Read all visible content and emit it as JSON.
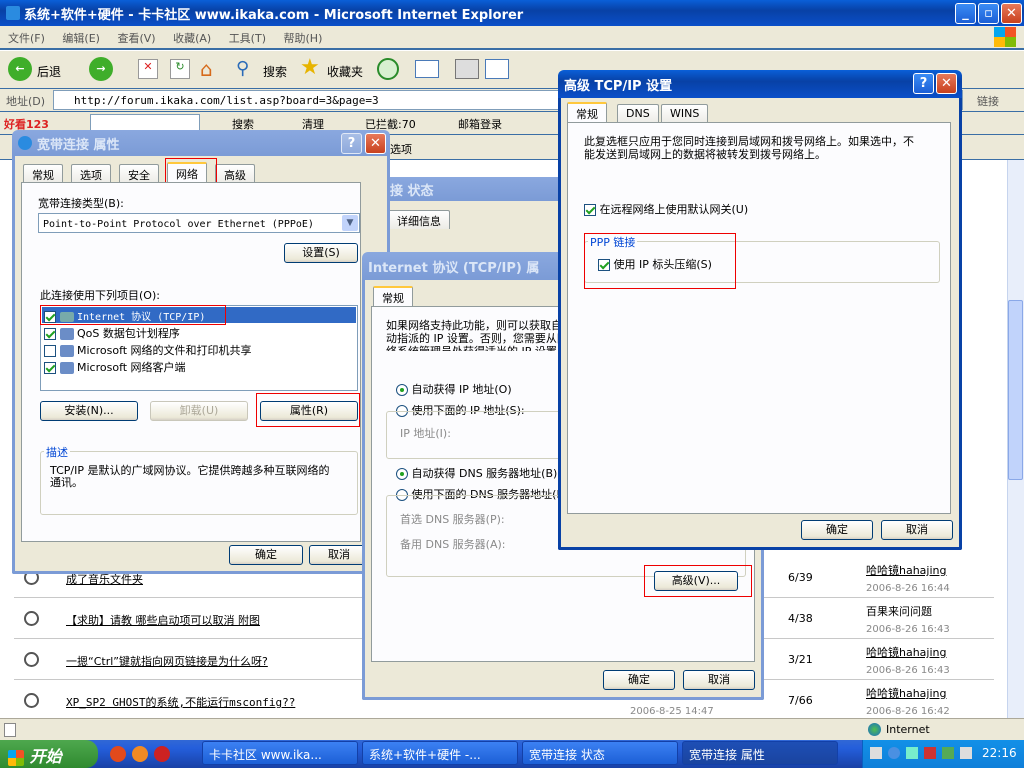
{
  "ie": {
    "title": "系统+软件+硬件 - 卡卡社区 www.ikaka.com - Microsoft Internet Explorer",
    "menu": [
      "文件(F)",
      "编辑(E)",
      "查看(V)",
      "收藏(A)",
      "工具(T)",
      "帮助(H)"
    ],
    "toolbar": {
      "back": "后退",
      "search": "搜索",
      "favorites": "收藏夹"
    },
    "address_label": "地址(D)",
    "address": "http://forum.ikaka.com/list.asp?board=3&page=3",
    "links": "链接",
    "bar3": {
      "logo": "好看123",
      "search": "搜索",
      "clean": "清理",
      "blocked": "已拦截:70",
      "mail": "邮箱登录"
    },
    "bar4": {
      "options": "选项"
    },
    "status": "Internet",
    "rows": [
      {
        "title": "成了音乐文件夹",
        "replies": "6/39",
        "author": "哈哈镜hahajing",
        "date": "2006-8-26 16:44"
      },
      {
        "title": "【求助】请教 哪些启动项可以取消 附图",
        "replies": "4/38",
        "author": "百果来问问题",
        "date": "2006-8-26 16:43"
      },
      {
        "title": "一摁“Ctrl”键就指向网页链接是为什么呀?",
        "replies": "3/21",
        "author": "哈哈镜hahajing",
        "date": "2006-8-26 16:43"
      },
      {
        "title": "XP_SP2 GHOST的系统,不能运行msconfig??",
        "replies": "7/66",
        "author": "哈哈镜hahajing",
        "date": "2006-8-26 16:42"
      }
    ],
    "date_under": "2006-8-25 14:47"
  },
  "status_dlg": {
    "title": "接 状态",
    "tab": "详细信息"
  },
  "props": {
    "title": "宽带连接 属性",
    "tabs": [
      "常规",
      "选项",
      "安全",
      "网络",
      "高级"
    ],
    "type_label": "宽带连接类型(B):",
    "type_value": "Point-to-Point Protocol over Ethernet (PPPoE)",
    "settings": "设置(S)",
    "items_label": "此连接使用下列项目(O):",
    "items": [
      {
        "label": "Internet 协议 (TCP/IP)",
        "checked": true
      },
      {
        "label": "QoS 数据包计划程序",
        "checked": true
      },
      {
        "label": "Microsoft 网络的文件和打印机共享",
        "checked": false
      },
      {
        "label": "Microsoft 网络客户端",
        "checked": true
      }
    ],
    "install": "安装(N)...",
    "uninstall": "卸载(U)",
    "properties": "属性(R)",
    "desc_label": "描述",
    "desc": "TCP/IP 是默认的广域网协议。它提供跨越多种互联网络的通讯。",
    "ok": "确定",
    "cancel": "取消"
  },
  "tcpip": {
    "title": "Internet 协议 (TCP/IP) 属",
    "tab": "常规",
    "desc": "如果网络支持此功能，则可以获取自动指派的 IP 设置。否则，您需要从网络系统管理员处获得适当的 IP 设置。",
    "auto_ip": "自动获得 IP 地址(O)",
    "manual_ip": "使用下面的 IP 地址(S):",
    "ip_label": "IP 地址(I):",
    "auto_dns": "自动获得 DNS 服务器地址(B)",
    "manual_dns": "使用下面的 DNS 服务器地址(E):",
    "pref_dns": "首选 DNS 服务器(P):",
    "alt_dns": "备用 DNS 服务器(A):",
    "advanced": "高级(V)...",
    "ok": "确定",
    "cancel": "取消"
  },
  "adv": {
    "title": "高级 TCP/IP 设置",
    "tabs": [
      "常规",
      "DNS",
      "WINS"
    ],
    "desc": "此复选框只应用于您同时连接到局域网和拨号网络上。如果选中，不能发送到局域网上的数据将被转发到拨号网络上。",
    "gateway": "在远程网络上使用默认网关(U)",
    "ppp_label": "PPP 链接",
    "ipcomp": "使用 IP 标头压缩(S)",
    "ok": "确定",
    "cancel": "取消"
  },
  "taskbar": {
    "start": "开始",
    "items": [
      "卡卡社区 www.ika...",
      "系统+软件+硬件 -...",
      "宽带连接 状态",
      "宽带连接 属性"
    ],
    "time": "22:16"
  }
}
